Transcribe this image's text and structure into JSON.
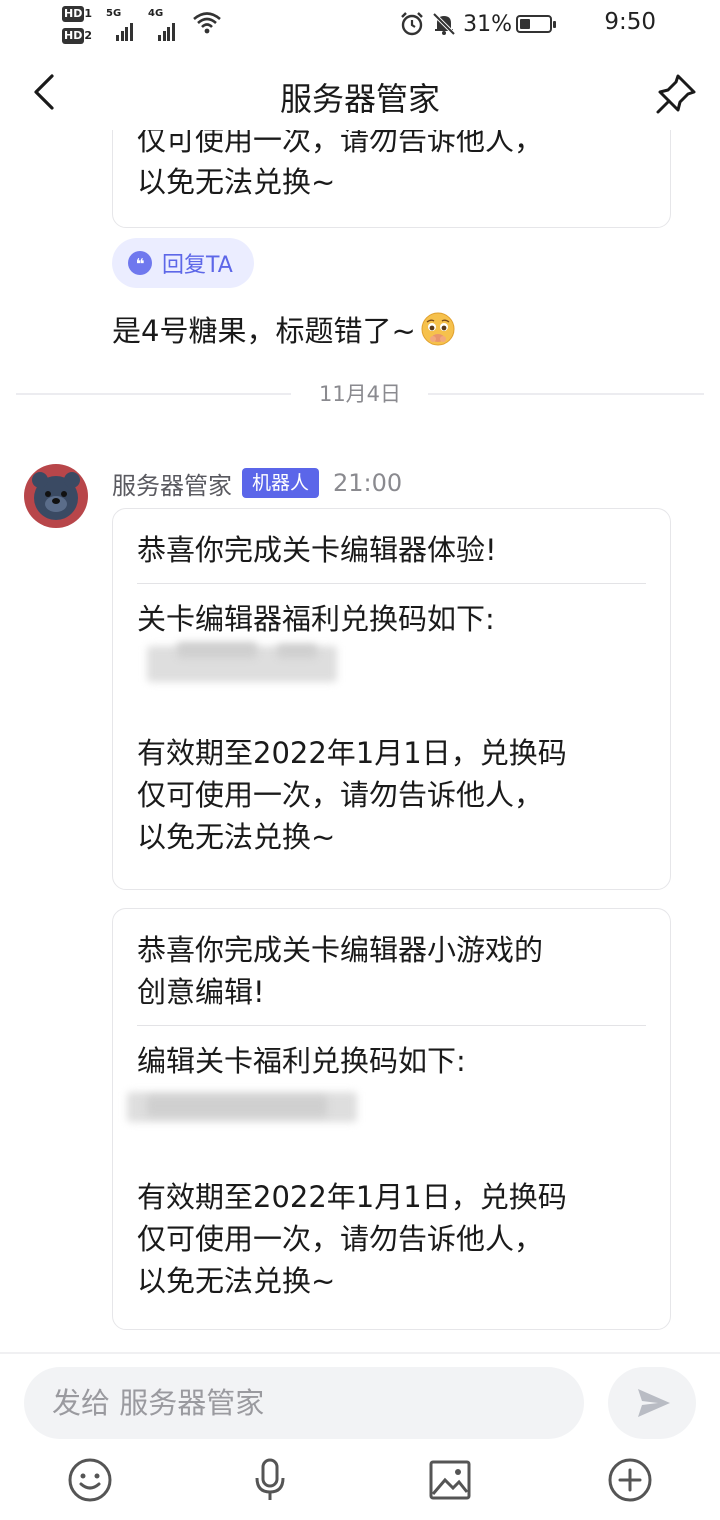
{
  "status_bar": {
    "sim1": "HD",
    "sim1_num": "1",
    "sim2": "HD",
    "sim2_num": "2",
    "net1": "5G",
    "net2": "4G",
    "battery": "31%",
    "time": "9:50"
  },
  "header": {
    "title": "服务器管家",
    "back_icon": "chevron-left-icon",
    "pin_icon": "pin-icon"
  },
  "previous_card": {
    "lines": [
      "仅可使用一次，请勿告诉他人，",
      "以免无法兑换~"
    ]
  },
  "reply_chip": {
    "label": "回复TA",
    "icon": "quote-icon"
  },
  "user_message": {
    "text": "是4号糖果，标题错了~",
    "emoji": "pleading-face-emoji"
  },
  "date_separator": "11月4日",
  "sender": {
    "name": "服务器管家",
    "badge": "机器人",
    "time": "21:00"
  },
  "cards": [
    {
      "heading": [
        "恭喜你完成关卡编辑器体验!"
      ],
      "code_label": "关卡编辑器福利兑换码如下:",
      "validity": [
        "有效期至2022年1月1日，兑换码",
        "仅可使用一次，请勿告诉他人，",
        "以免无法兑换~"
      ]
    },
    {
      "heading": [
        "恭喜你完成关卡编辑器小游戏的",
        "创意编辑!"
      ],
      "code_label": "编辑关卡福利兑换码如下:",
      "validity": [
        "有效期至2022年1月1日，兑换码",
        "仅可使用一次，请勿告诉他人，",
        "以免无法兑换~"
      ]
    }
  ],
  "composer": {
    "placeholder": "发给 服务器管家",
    "send_icon": "send-icon",
    "tools": [
      "emoji-icon",
      "microphone-icon",
      "image-icon",
      "plus-circle-icon"
    ]
  },
  "colors": {
    "accent": "#5b66e9",
    "chip_bg": "#ebedff",
    "avatar_bg": "#b8464a"
  }
}
